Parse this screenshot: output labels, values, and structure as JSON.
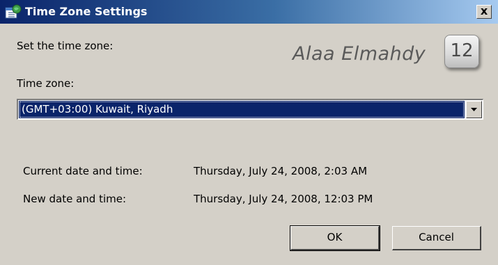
{
  "window": {
    "title": "Time Zone Settings",
    "close_label": "x"
  },
  "prompt": "Set the time zone:",
  "watermark": {
    "text": "Alaa Elmahdy",
    "badge": "12"
  },
  "timezone": {
    "label": "Time zone:",
    "selected": "(GMT+03:00) Kuwait, Riyadh"
  },
  "current": {
    "label": "Current date and time:",
    "value": "Thursday, July 24, 2008, 2:03 AM"
  },
  "new": {
    "label": "New date and time:",
    "value": "Thursday, July 24, 2008, 12:03 PM"
  },
  "buttons": {
    "ok": "OK",
    "cancel": "Cancel"
  },
  "colors": {
    "titlebar_start": "#0a246a",
    "titlebar_end": "#a6caf0",
    "window_bg": "#d4d0c8",
    "selection": "#0a246a"
  }
}
